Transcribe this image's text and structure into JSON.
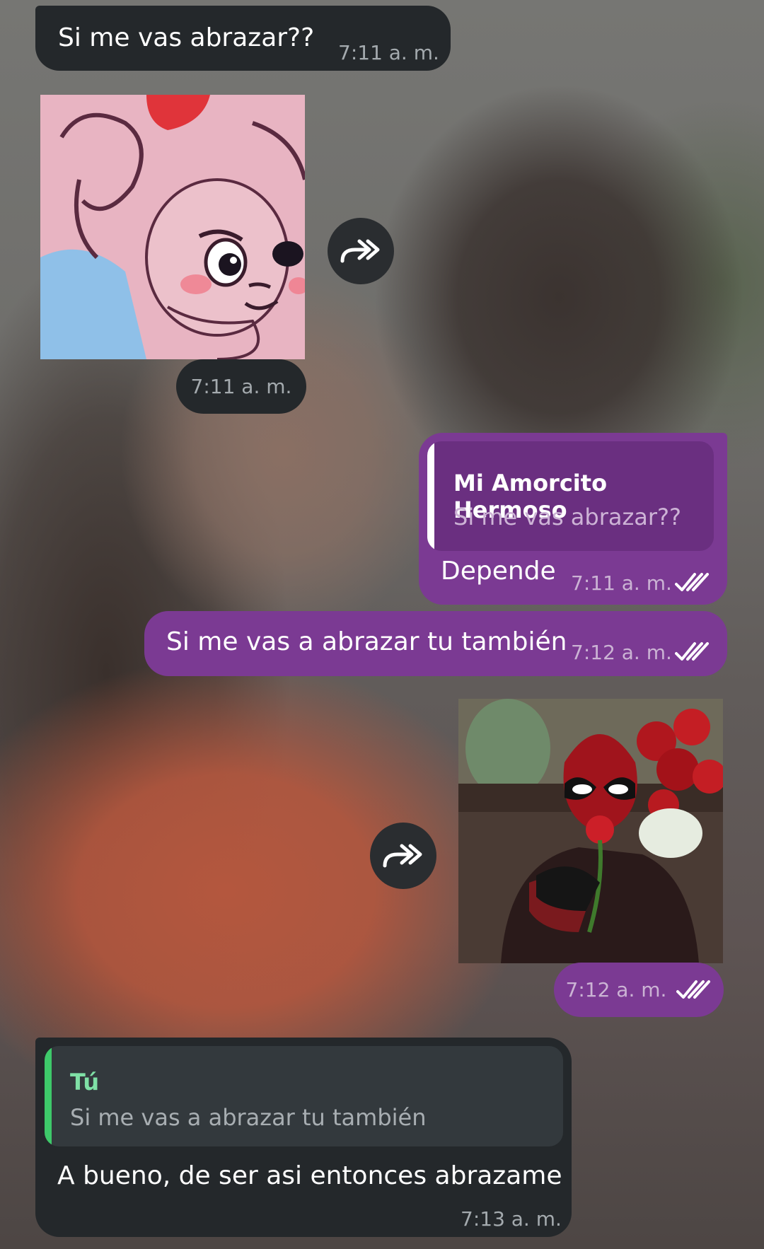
{
  "messages": [
    {
      "id": "m1",
      "direction": "incoming",
      "text": "Si me vas abrazar??",
      "time": "7:11 a. m."
    },
    {
      "id": "m2",
      "direction": "incoming",
      "type": "sticker",
      "sticker": "pink-mouse-sticker",
      "time": "7:11 a. m."
    },
    {
      "id": "m3",
      "direction": "outgoing",
      "reply_to": {
        "name": "Mi Amorcito Hermoso",
        "text": "Si me vas abrazar??"
      },
      "text": "Depende",
      "time": "7:11 a. m.",
      "status": "read"
    },
    {
      "id": "m4",
      "direction": "outgoing",
      "text": "Si me vas a abrazar tu también",
      "time": "7:12 a. m.",
      "status": "read"
    },
    {
      "id": "m5",
      "direction": "outgoing",
      "type": "sticker",
      "sticker": "deadpool-rose-sticker",
      "time": "7:12 a. m.",
      "status": "read"
    },
    {
      "id": "m6",
      "direction": "incoming",
      "reply_to": {
        "name": "Tú",
        "text": "Si me vas a abrazar tu también"
      },
      "text": "A bueno, de ser asi entonces abrazame",
      "time": "7:13 a. m."
    }
  ],
  "icons": {
    "share": "share-forward-icon",
    "read": "double-check-icon"
  },
  "colors": {
    "incoming_bubble": "#24282b",
    "outgoing_bubble": "#7b3a93",
    "reply_bar_outgoing": "#ffffff",
    "reply_bar_incoming": "#3ec96a",
    "reply_name_incoming": "#7fe0a6"
  }
}
